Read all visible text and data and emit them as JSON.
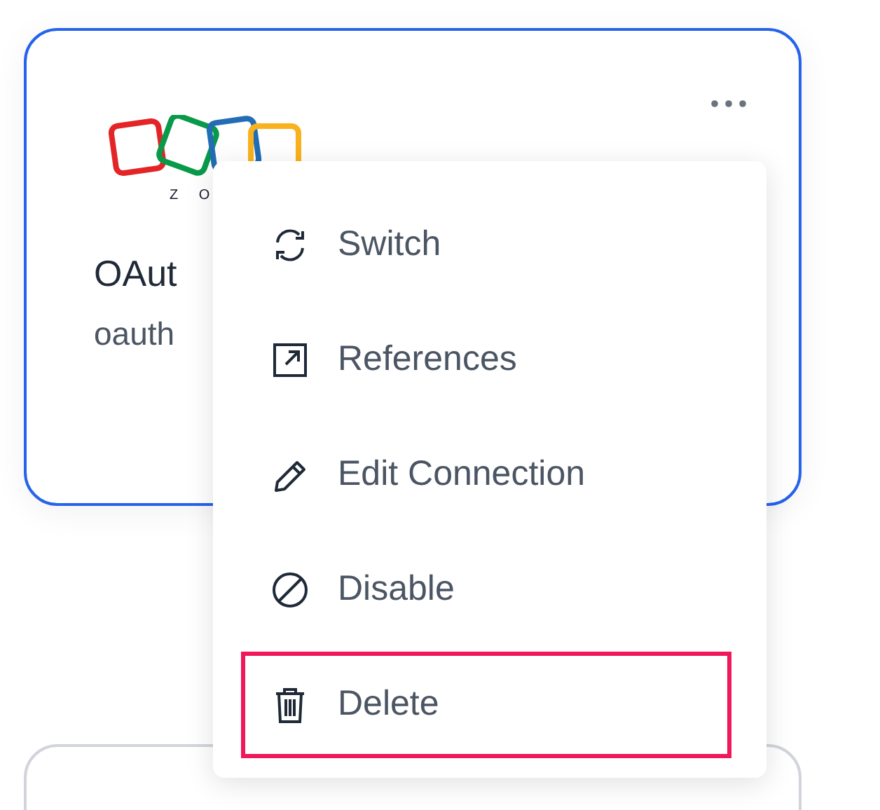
{
  "card": {
    "logo_text": "Z O",
    "title": "OAut",
    "subtitle": "oauth",
    "selected": true
  },
  "menu": {
    "items": [
      {
        "kind": "switch",
        "label": "Switch",
        "highlighted": false
      },
      {
        "kind": "references",
        "label": "References",
        "highlighted": false
      },
      {
        "kind": "edit",
        "label": "Edit Connection",
        "highlighted": false
      },
      {
        "kind": "disable",
        "label": "Disable",
        "highlighted": false
      },
      {
        "kind": "delete",
        "label": "Delete",
        "highlighted": true
      }
    ]
  }
}
